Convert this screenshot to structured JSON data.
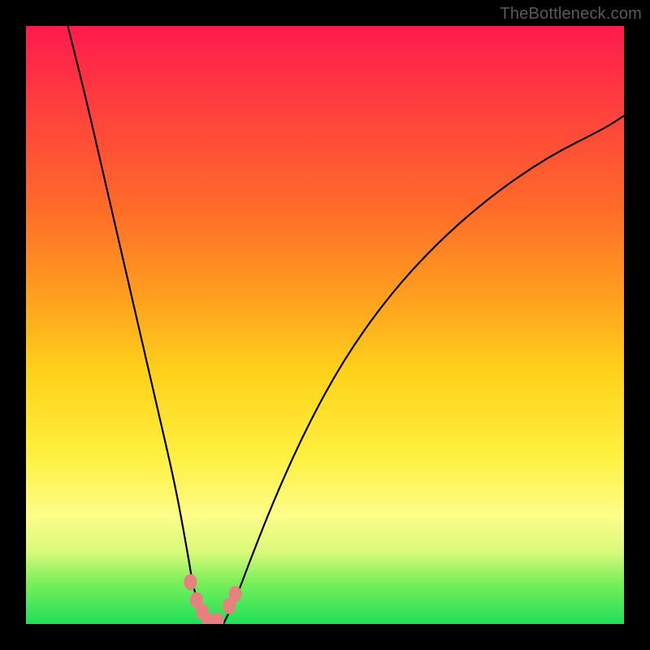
{
  "watermark": "TheBottleneck.com",
  "colors": {
    "frame": "#000000",
    "curve_stroke": "#000000",
    "marker_fill": "#e98080",
    "gradient_top": "#ff1a4d",
    "gradient_bottom": "#1fe05a"
  },
  "chart_data": {
    "type": "line",
    "title": "",
    "xlabel": "",
    "ylabel": "",
    "xlim": [
      0,
      100
    ],
    "ylim": [
      0,
      100
    ],
    "grid": false,
    "axes_visible": false,
    "notes": "Two V-shaped bottleneck curves on a red→green vertical gradient; y≈100 is worst (red), y≈0 is best (green). Curves nearly meet at the trough around x≈28–33 with y≈0–2. A small cluster of pink markers sits at/near the trough.",
    "series": [
      {
        "name": "left-branch",
        "x": [
          7,
          10,
          13,
          16,
          19,
          22,
          25,
          27,
          28,
          29,
          30,
          31
        ],
        "y": [
          100,
          88,
          75,
          62,
          49,
          36,
          23,
          12,
          6,
          3,
          1,
          0
        ]
      },
      {
        "name": "right-branch",
        "x": [
          33,
          35,
          38,
          42,
          47,
          53,
          60,
          68,
          77,
          87,
          97,
          100
        ],
        "y": [
          0,
          4,
          12,
          22,
          33,
          44,
          54,
          63,
          71,
          78,
          83,
          85
        ]
      }
    ],
    "markers": [
      {
        "x": 27.5,
        "y": 7
      },
      {
        "x": 28.5,
        "y": 4
      },
      {
        "x": 29.5,
        "y": 2
      },
      {
        "x": 30.5,
        "y": 0.5
      },
      {
        "x": 32.0,
        "y": 0.5
      },
      {
        "x": 34.0,
        "y": 3
      },
      {
        "x": 35.0,
        "y": 5
      }
    ]
  }
}
